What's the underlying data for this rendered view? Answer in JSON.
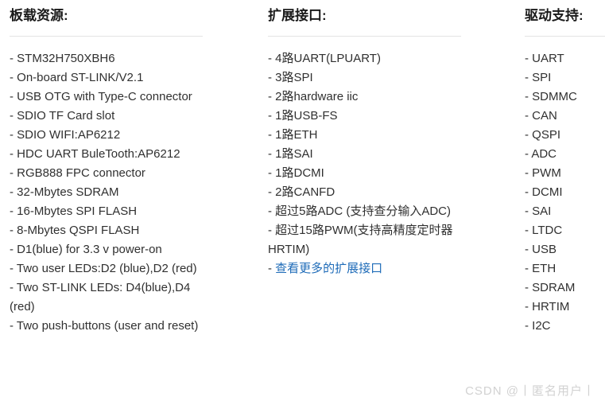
{
  "columns": [
    {
      "id": "onboard",
      "heading": "板载资源:",
      "items": [
        "- STM32H750XBH6",
        "- On-board ST-LINK/V2.1",
        "- USB OTG with Type-C connector",
        "- SDIO TF Card slot",
        "- SDIO WIFI:AP6212",
        "- HDC UART BuleTooth:AP6212",
        "- RGB888 FPC connector",
        "- 32-Mbytes SDRAM",
        "- 16-Mbytes SPI FLASH",
        "- 8-Mbytes QSPI FLASH",
        "- D1(blue) for 3.3 v power-on",
        "- Two user LEDs:D2 (blue),D2 (red)",
        "- Two ST-LINK LEDs: D4(blue),D4 (red)",
        "- Two push-buttons (user and reset)"
      ]
    },
    {
      "id": "expand",
      "heading": "扩展接口:",
      "items": [
        "- 4路UART(LPUART)",
        "- 3路SPI",
        "- 2路hardware iic",
        "- 1路USB-FS",
        "- 1路ETH",
        "- 1路SAI",
        "- 1路DCMI",
        "- 2路CANFD",
        "- 超过5路ADC (支持查分输入ADC)",
        "- 超过15路PWM(支持高精度定时器HRTIM)"
      ],
      "link_item": {
        "dash": "- ",
        "label": "查看更多的扩展接口",
        "color": "#1e6bb8"
      }
    },
    {
      "id": "driver",
      "heading": "驱动支持:",
      "items": [
        "- UART",
        "- SPI",
        "- SDMMC",
        "- CAN",
        "- QSPI",
        "- ADC",
        "- PWM",
        "- DCMI",
        "- SAI",
        "- LTDC",
        "- USB",
        "- ETH",
        "- SDRAM",
        "- HRTIM",
        "- I2C"
      ]
    }
  ],
  "watermark": {
    "text": "CSDN @丨匿名用户丨"
  },
  "theme": {
    "background": "#ffffff",
    "text": "#303030",
    "heading": "#1a1a1a",
    "rule": "#e3e3e3",
    "link": "#1e6bb8",
    "watermark": "#d2d2d2"
  }
}
